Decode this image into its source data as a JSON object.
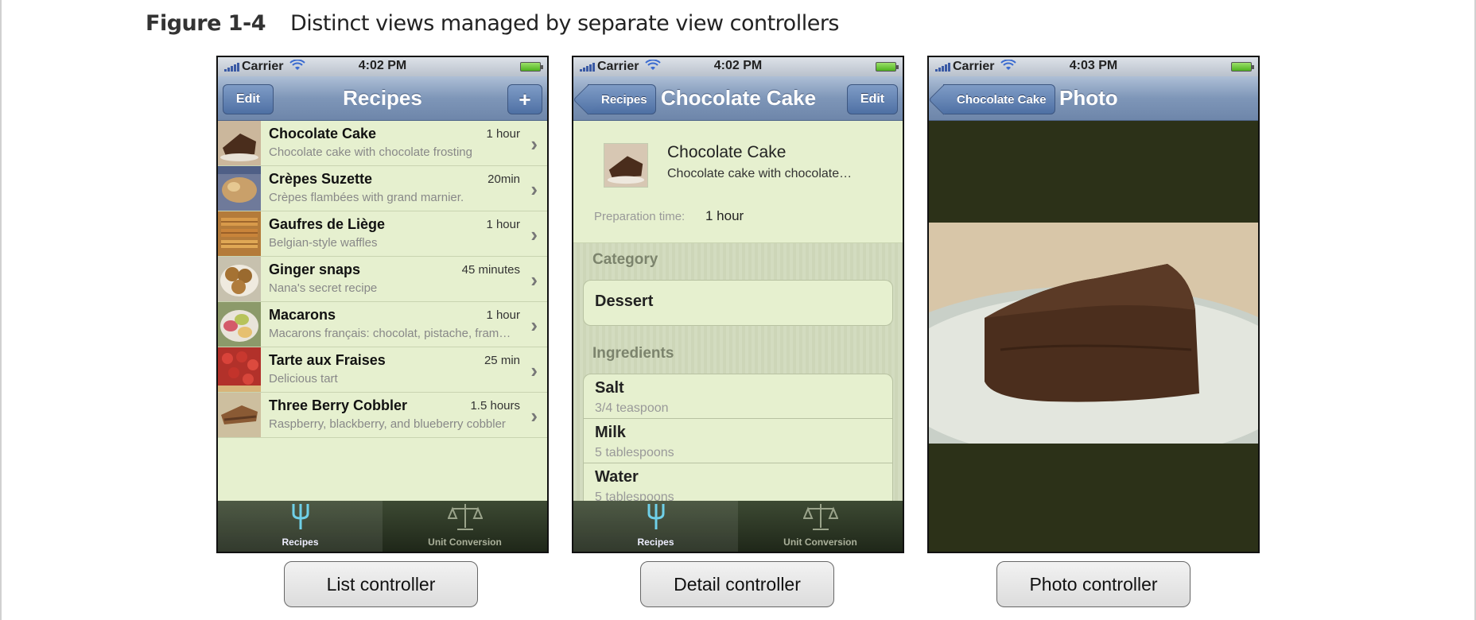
{
  "figure": {
    "label": "Figure 1-4",
    "caption": "Distinct views managed by separate view controllers"
  },
  "status": {
    "carrier": "Carrier",
    "time_list": "4:02 PM",
    "time_detail": "4:02 PM",
    "time_photo": "4:03 PM"
  },
  "list_screen": {
    "title": "Recipes",
    "edit_label": "Edit",
    "add_label": "+",
    "rows": [
      {
        "name": "Chocolate Cake",
        "desc": "Chocolate cake with chocolate frosting",
        "time": "1 hour"
      },
      {
        "name": "Crèpes Suzette",
        "desc": "Crèpes flambées with grand marnier.",
        "time": "20min"
      },
      {
        "name": "Gaufres de Liège",
        "desc": "Belgian-style waffles",
        "time": "1 hour"
      },
      {
        "name": "Ginger snaps",
        "desc": "Nana's secret recipe",
        "time": "45 minutes"
      },
      {
        "name": "Macarons",
        "desc": "Macarons français: chocolat, pistache, fram…",
        "time": "1 hour"
      },
      {
        "name": "Tarte aux Fraises",
        "desc": "Delicious tart",
        "time": "25 min"
      },
      {
        "name": "Three Berry Cobbler",
        "desc": "Raspberry, blackberry, and blueberry cobbler",
        "time": "1.5 hours"
      }
    ]
  },
  "detail_screen": {
    "back_label": "Recipes",
    "title": "Chocolate Cake",
    "edit_label": "Edit",
    "recipe_name": "Chocolate Cake",
    "recipe_desc": "Chocolate cake with chocolate…",
    "prep_label": "Preparation time:",
    "prep_value": "1 hour",
    "category_header": "Category",
    "category_value": "Dessert",
    "ingredients_header": "Ingredients",
    "ingredients": [
      {
        "name": "Salt",
        "amount": "3/4 teaspoon"
      },
      {
        "name": "Milk",
        "amount": "5 tablespoons"
      },
      {
        "name": "Water",
        "amount": "5 tablespoons"
      }
    ]
  },
  "photo_screen": {
    "back_label": "Chocolate Cake",
    "title": "Photo"
  },
  "tabs": {
    "recipes": "Recipes",
    "unit_conversion": "Unit Conversion"
  },
  "controllers": {
    "list": "List controller",
    "detail": "Detail controller",
    "photo": "Photo controller"
  },
  "colors": {
    "list_background": "#e6f0cf",
    "navbar": "#7e96b8",
    "tabbar": "#1f2719",
    "photo_background": "#2c3118"
  },
  "icons": [
    "fork-icon",
    "scale-icon",
    "wifi-icon",
    "battery-icon",
    "chevron-right-icon",
    "plus-icon"
  ]
}
